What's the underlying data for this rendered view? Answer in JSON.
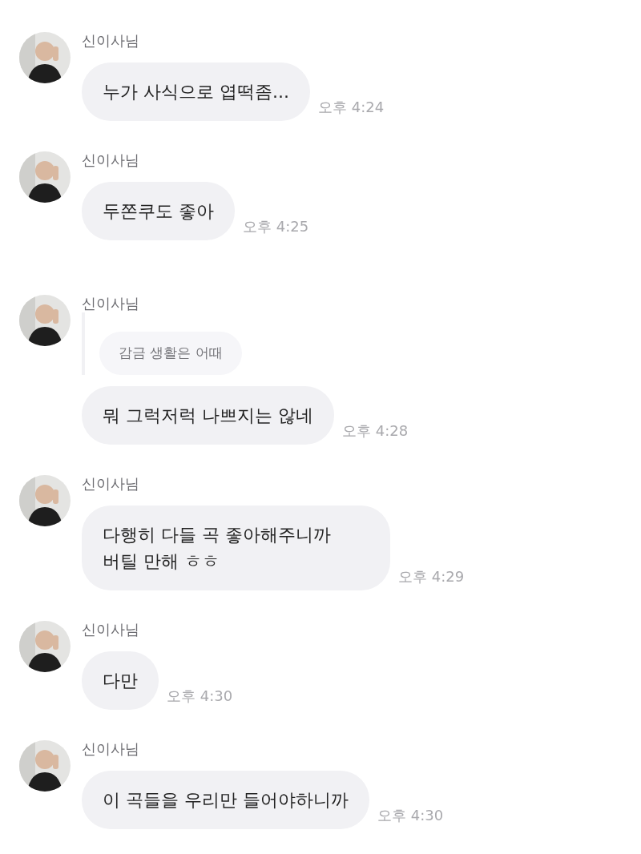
{
  "messages": [
    {
      "sender": "신이사님",
      "text": "누가 사식으로 엽떡좀...",
      "time": "오후 4:24"
    },
    {
      "sender": "신이사님",
      "text": "두쫀쿠도 좋아",
      "time": "오후 4:25"
    },
    {
      "sender": "신이사님",
      "quote": "감금 생활은 어때",
      "text": "뭐 그럭저럭 나쁘지는 않네",
      "time": "오후 4:28"
    },
    {
      "sender": "신이사님",
      "text": "다행히 다들 곡 좋아해주니까 버틸 만해 ㅎㅎ",
      "time": "오후 4:29"
    },
    {
      "sender": "신이사님",
      "text": "다만",
      "time": "오후 4:30"
    },
    {
      "sender": "신이사님",
      "text": "이 곡들을 우리만 들어야하니까",
      "time": "오후 4:30"
    }
  ]
}
